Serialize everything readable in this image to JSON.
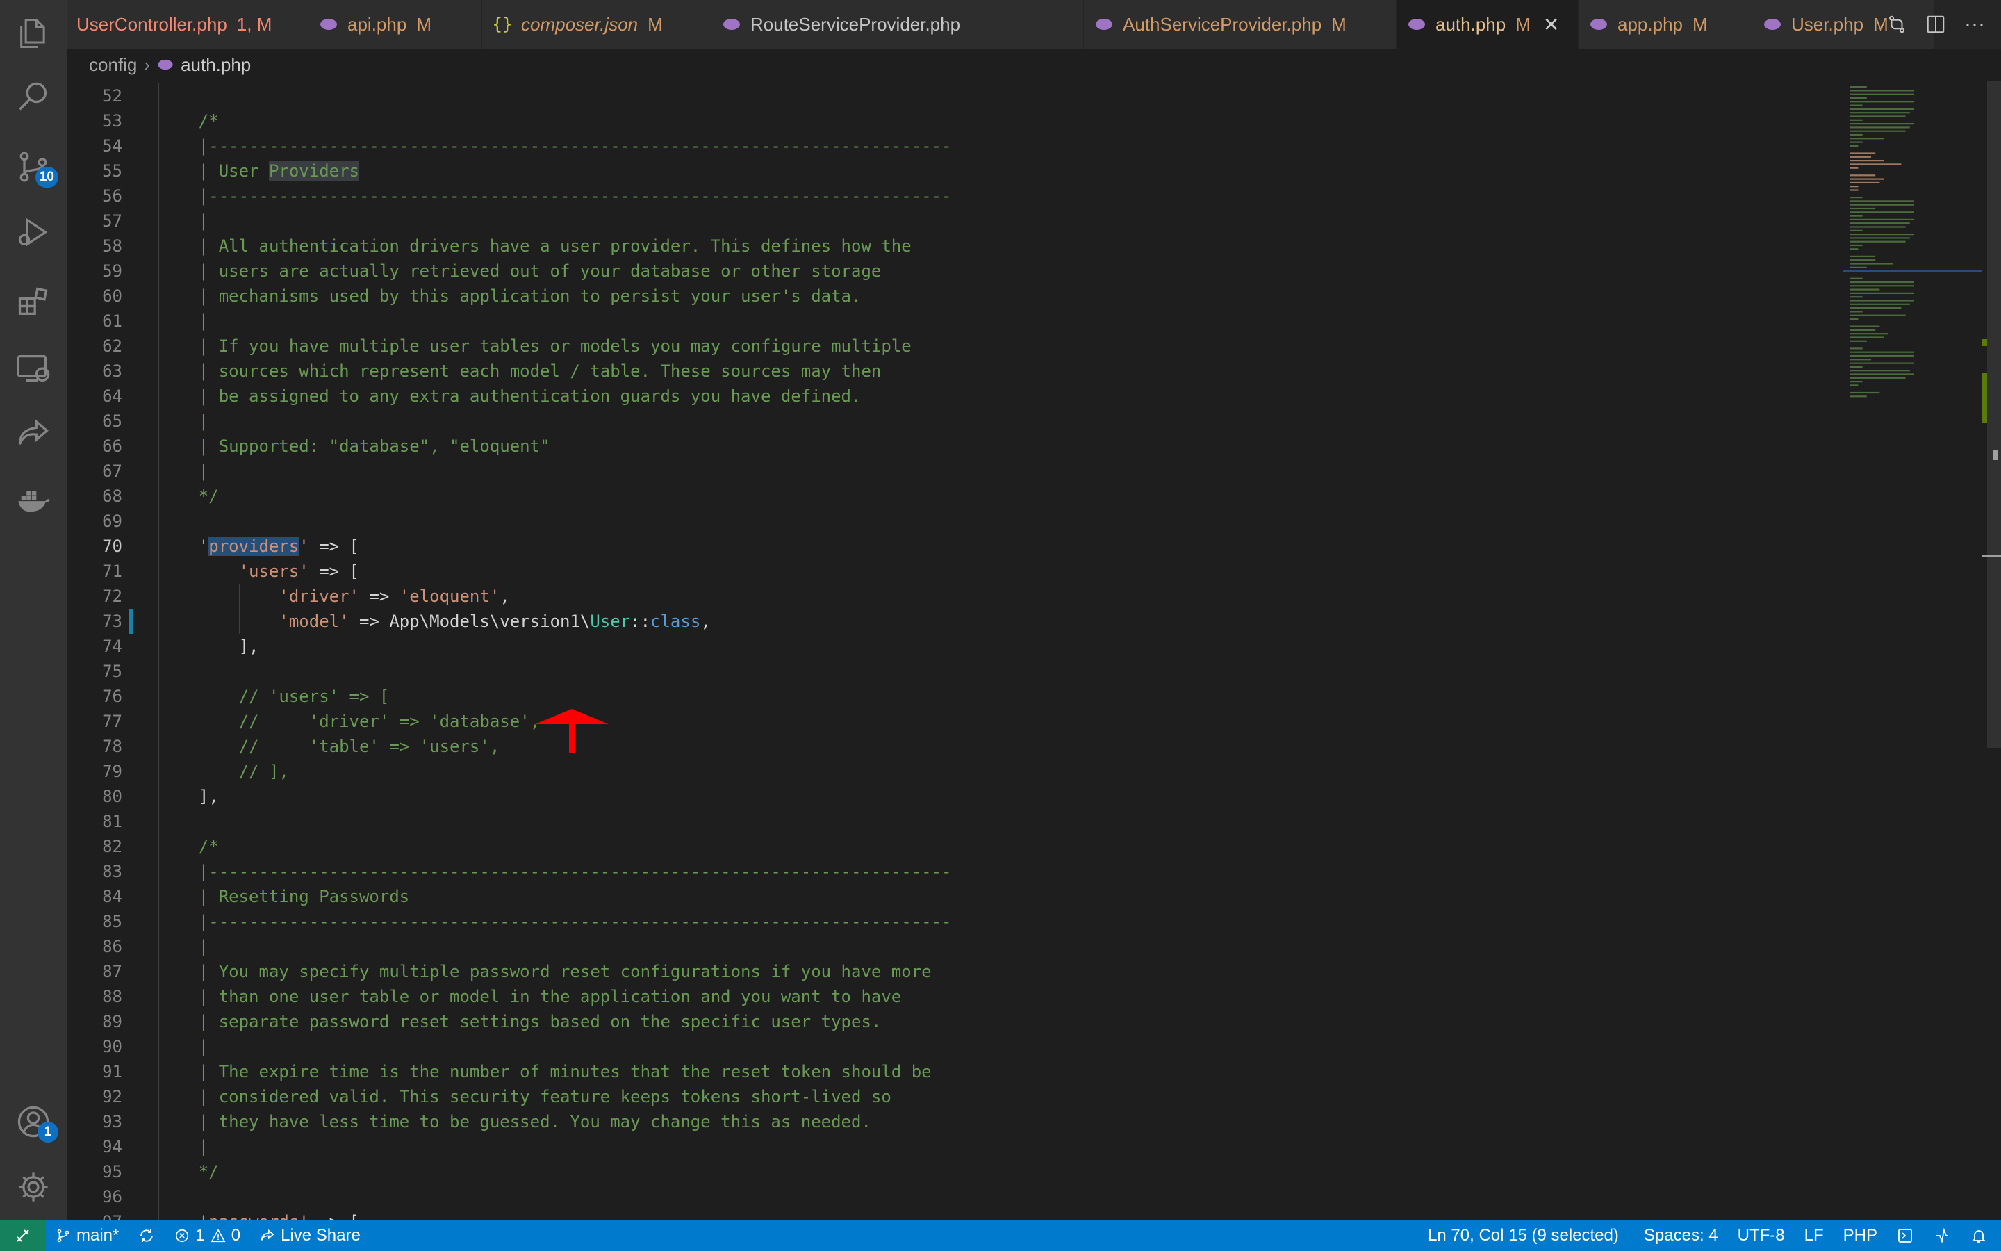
{
  "activity_bar": {
    "items": [
      {
        "name": "explorer-icon"
      },
      {
        "name": "search-icon"
      },
      {
        "name": "source-control-icon",
        "badge": "10"
      },
      {
        "name": "run-debug-icon"
      },
      {
        "name": "extensions-icon"
      },
      {
        "name": "remote-explorer-icon"
      },
      {
        "name": "live-share-icon"
      },
      {
        "name": "docker-icon"
      }
    ],
    "bottom": [
      {
        "name": "accounts-icon",
        "badge": "1"
      },
      {
        "name": "manage-gear-icon"
      }
    ]
  },
  "tabs": [
    {
      "label": "UserController.php",
      "status": "1, M",
      "icon": "php-elephant-icon"
    },
    {
      "label": "api.php",
      "status": "M",
      "icon": "php-elephant-icon"
    },
    {
      "label": "composer.json",
      "status": "M",
      "icon": "json-braces-icon"
    },
    {
      "label": "RouteServiceProvider.php",
      "status": "",
      "icon": "php-elephant-icon"
    },
    {
      "label": "AuthServiceProvider.php",
      "status": "M",
      "icon": "php-elephant-icon"
    },
    {
      "label": "auth.php",
      "status": "M",
      "icon": "php-elephant-icon",
      "active": true
    },
    {
      "label": "app.php",
      "status": "M",
      "icon": "php-elephant-icon"
    },
    {
      "label": "User.php",
      "status": "M",
      "icon": "php-elephant-icon"
    }
  ],
  "tab_close_glyph": "✕",
  "tab_actions": {
    "more": "···"
  },
  "breadcrumb": {
    "folder": "config",
    "file": "auth.php"
  },
  "editor": {
    "current_line": 70,
    "lines": [
      {
        "n": 52,
        "text": ""
      },
      {
        "n": 53,
        "text": "    /*"
      },
      {
        "n": 54,
        "text": "    |--------------------------------------------------------------------------"
      },
      {
        "n": 55,
        "text": "    | User Providers"
      },
      {
        "n": 56,
        "text": "    |--------------------------------------------------------------------------"
      },
      {
        "n": 57,
        "text": "    |"
      },
      {
        "n": 58,
        "text": "    | All authentication drivers have a user provider. This defines how the"
      },
      {
        "n": 59,
        "text": "    | users are actually retrieved out of your database or other storage"
      },
      {
        "n": 60,
        "text": "    | mechanisms used by this application to persist your user's data."
      },
      {
        "n": 61,
        "text": "    |"
      },
      {
        "n": 62,
        "text": "    | If you have multiple user tables or models you may configure multiple"
      },
      {
        "n": 63,
        "text": "    | sources which represent each model / table. These sources may then"
      },
      {
        "n": 64,
        "text": "    | be assigned to any extra authentication guards you have defined."
      },
      {
        "n": 65,
        "text": "    |"
      },
      {
        "n": 66,
        "text": "    | Supported: \"database\", \"eloquent\""
      },
      {
        "n": 67,
        "text": "    |"
      },
      {
        "n": 68,
        "text": "    */"
      },
      {
        "n": 69,
        "text": ""
      },
      {
        "n": 70,
        "text": "    'providers' => ["
      },
      {
        "n": 71,
        "text": "        'users' => ["
      },
      {
        "n": 72,
        "text": "            'driver' => 'eloquent',"
      },
      {
        "n": 73,
        "text": "            'model' => App\\Models\\version1\\User::class,"
      },
      {
        "n": 74,
        "text": "        ],"
      },
      {
        "n": 75,
        "text": ""
      },
      {
        "n": 76,
        "text": "        // 'users' => ["
      },
      {
        "n": 77,
        "text": "        //     'driver' => 'database',"
      },
      {
        "n": 78,
        "text": "        //     'table' => 'users',"
      },
      {
        "n": 79,
        "text": "        // ],"
      },
      {
        "n": 80,
        "text": "    ],"
      },
      {
        "n": 81,
        "text": ""
      },
      {
        "n": 82,
        "text": "    /*"
      },
      {
        "n": 83,
        "text": "    |--------------------------------------------------------------------------"
      },
      {
        "n": 84,
        "text": "    | Resetting Passwords"
      },
      {
        "n": 85,
        "text": "    |--------------------------------------------------------------------------"
      },
      {
        "n": 86,
        "text": "    |"
      },
      {
        "n": 87,
        "text": "    | You may specify multiple password reset configurations if you have more"
      },
      {
        "n": 88,
        "text": "    | than one user table or model in the application and you want to have"
      },
      {
        "n": 89,
        "text": "    | separate password reset settings based on the specific user types."
      },
      {
        "n": 90,
        "text": "    |"
      },
      {
        "n": 91,
        "text": "    | The expire time is the number of minutes that the reset token should be"
      },
      {
        "n": 92,
        "text": "    | considered valid. This security feature keeps tokens short-lived so"
      },
      {
        "n": 93,
        "text": "    | they have less time to be guessed. You may change this as needed."
      },
      {
        "n": 94,
        "text": "    |"
      },
      {
        "n": 95,
        "text": "    */"
      },
      {
        "n": 96,
        "text": ""
      },
      {
        "n": 97,
        "text": "    'passwords' => ["
      }
    ]
  },
  "status_bar": {
    "branch": "main*",
    "errors": "1",
    "warnings": "0",
    "live_share": "Live Share",
    "position": "Ln 70, Col 15 (9 selected)",
    "indent": "Spaces: 4",
    "encoding": "UTF-8",
    "eol": "LF",
    "language": "PHP"
  },
  "colors": {
    "accent": "#007acc",
    "comment": "#6a9955",
    "string": "#ce9178",
    "modified": "#d19a66",
    "error": "#f48771",
    "annotation_arrow": "#ff0000"
  }
}
